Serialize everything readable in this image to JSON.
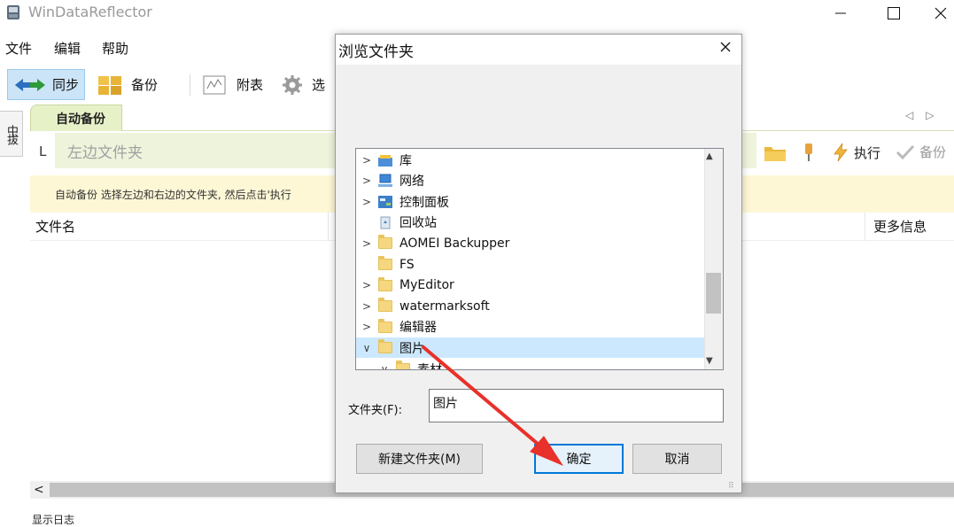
{
  "window": {
    "title": "WinDataReflector",
    "controls": {
      "minimize": "—",
      "maximize": "☐",
      "close": "✕"
    }
  },
  "menu": [
    "文件",
    "编辑",
    "帮助"
  ],
  "toolbar": {
    "sync": "同步",
    "backup": "备份",
    "attach": "附表",
    "options": "选"
  },
  "left_strip_label": "中拔",
  "tabs": {
    "active": "自动备份",
    "nav": "◁▷"
  },
  "path_row": {
    "left_marker": "L",
    "left_placeholder": "左边文件夹",
    "run": "执行",
    "backup": "备份"
  },
  "info": {
    "text": "自动备份   选择左边和右边的文件夹, 然后点击'执行"
  },
  "list": {
    "col_filename": "文件名",
    "col_more": "更多信息"
  },
  "status": {
    "log": "显示日志",
    "scroll_left": "<"
  },
  "dialog": {
    "title": "浏览文件夹",
    "tree": [
      {
        "label": "库",
        "chevron": ">",
        "icon": "library-icon"
      },
      {
        "label": "网络",
        "chevron": ">",
        "icon": "network-icon"
      },
      {
        "label": "控制面板",
        "chevron": ">",
        "icon": "control-panel-icon"
      },
      {
        "label": "回收站",
        "chevron": "",
        "icon": "recycle-bin-icon"
      },
      {
        "label": "AOMEI Backupper",
        "chevron": ">",
        "icon": "folder-icon"
      },
      {
        "label": "FS",
        "chevron": "",
        "icon": "folder-icon"
      },
      {
        "label": "MyEditor",
        "chevron": ">",
        "icon": "folder-icon"
      },
      {
        "label": "watermarksoft",
        "chevron": ">",
        "icon": "folder-icon"
      },
      {
        "label": "编辑器",
        "chevron": ">",
        "icon": "folder-icon"
      },
      {
        "label": "图片",
        "chevron": "∨",
        "icon": "folder-icon",
        "selected": true
      },
      {
        "label": "素材",
        "chevron": "∨",
        "icon": "folder-icon"
      }
    ],
    "folder_label": "文件夹(F):",
    "folder_value": "图片",
    "new_folder": "新建文件夹(M)",
    "ok": "确定",
    "cancel": "取消"
  },
  "colors": {
    "accent": "#0078d7",
    "annotation_arrow": "#e8312a",
    "tab_green": "#e7f1c8",
    "info_yellow": "#fdf7d6"
  }
}
